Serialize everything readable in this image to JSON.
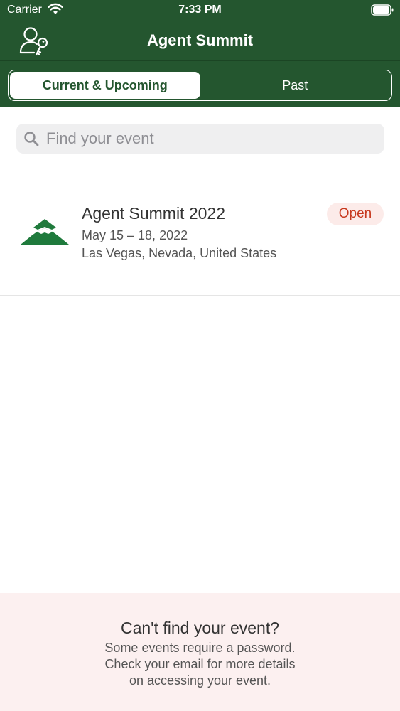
{
  "status_bar": {
    "carrier": "Carrier",
    "time": "7:33 PM"
  },
  "nav": {
    "title": "Agent Summit",
    "account_icon": "user-key-icon"
  },
  "segments": [
    {
      "label": "Current & Upcoming",
      "selected": true
    },
    {
      "label": "Past",
      "selected": false
    }
  ],
  "search": {
    "placeholder": "Find your event",
    "value": ""
  },
  "events": [
    {
      "title": "Agent Summit 2022",
      "dates": "May 15 – 18, 2022",
      "location": "Las Vegas, Nevada, United States",
      "status": "Open"
    }
  ],
  "footer": {
    "title": "Can't find your event?",
    "lines": [
      "Some events require a password.",
      "Check your email for more details",
      "on accessing your event."
    ]
  },
  "colors": {
    "header_green": "#24562f",
    "logo_green": "#1f7a3c",
    "status_open_text": "#c7391f",
    "status_open_bg": "#fcebe9",
    "footer_bg": "#fcf0f0"
  }
}
